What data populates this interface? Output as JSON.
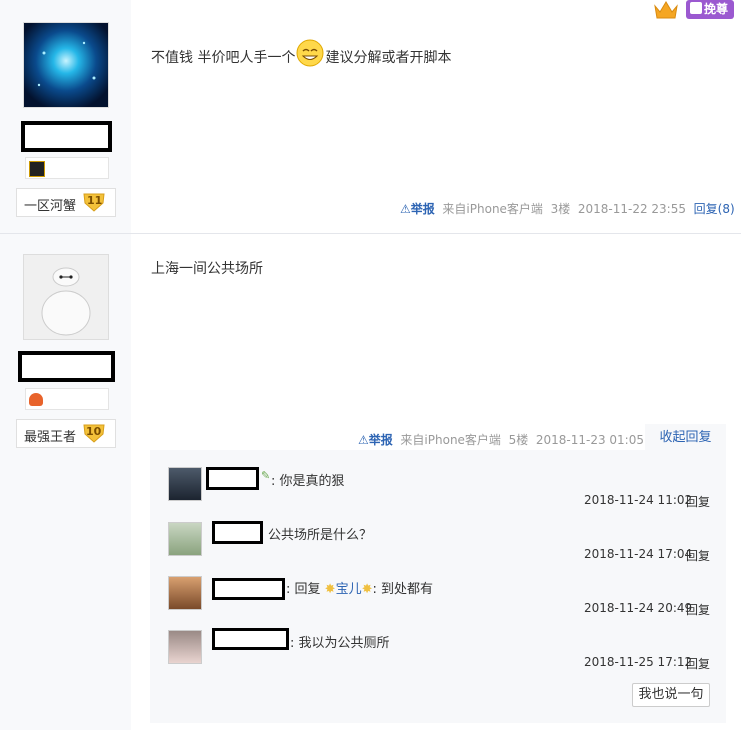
{
  "header": {
    "crown_icon": "crown-icon",
    "vip_label": "挽尊"
  },
  "posts": [
    {
      "rank_title": "一区河蟹",
      "level": "11",
      "content_before_emoji": "不值钱 半价吧人手一个",
      "content_after_emoji": "建议分解或者开脚本",
      "report_label": "举报",
      "source": "来自iPhone客户端",
      "floor": "3楼",
      "time": "2018-11-22 23:55",
      "reply_label": "回复(8)"
    },
    {
      "rank_title": "最强王者",
      "level": "10",
      "content": "上海一间公共场所",
      "report_label": "举报",
      "source": "来自iPhone客户端",
      "floor": "5楼",
      "time": "2018-11-23 01:05",
      "collapse_label": "收起回复",
      "replies": [
        {
          "text": ": 你是真的狠",
          "time": "2018-11-24 11:02",
          "reply_label": "回复"
        },
        {
          "text": "公共场所是什么？",
          "time": "2018-11-24 17:04",
          "reply_label": "回复"
        },
        {
          "text_prefix": ": 回复 ",
          "mention": "宝儿",
          "text_suffix": ": 到处都有",
          "time": "2018-11-24 20:49",
          "reply_label": "回复"
        },
        {
          "text": ": 我以为公共厕所",
          "time": "2018-11-25 17:12",
          "reply_label": "回复"
        }
      ],
      "say_button": "我也说一句"
    }
  ],
  "colors": {
    "link": "#2d64b3",
    "level_badge": "#f3c13a",
    "vip": "#9b59d0"
  }
}
